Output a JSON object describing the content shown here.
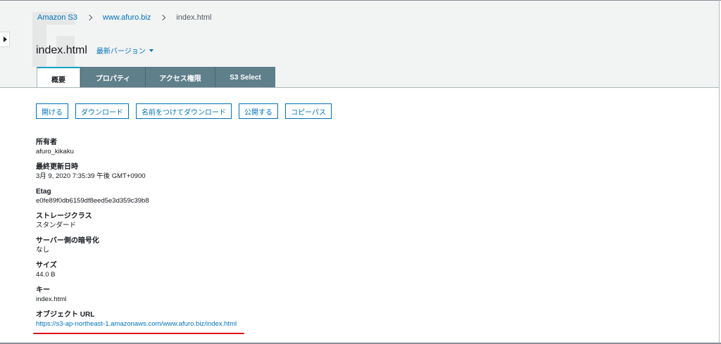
{
  "breadcrumb": {
    "root": "Amazon S3",
    "bucket": "www.afuro.biz",
    "object": "index.html"
  },
  "title": {
    "name": "index.html",
    "version_label": "最新バージョン"
  },
  "tabs": [
    {
      "label": "概要",
      "active": true
    },
    {
      "label": "プロパティ",
      "active": false
    },
    {
      "label": "アクセス権限",
      "active": false
    },
    {
      "label": "S3 Select",
      "active": false
    }
  ],
  "actions": {
    "open": "開ける",
    "download": "ダウンロード",
    "download_as": "名前をつけてダウンロード",
    "make_public": "公開する",
    "copy_path": "コピーパス"
  },
  "properties": {
    "owner": {
      "label": "所有者",
      "value": "afuro_kikaku"
    },
    "last_modified": {
      "label": "最終更新日時",
      "value": "3月 9, 2020 7:35:39 午後 GMT+0900"
    },
    "etag": {
      "label": "Etag",
      "value": "e0fe89f0db6159df8eed5e3d359c39b8"
    },
    "storage_class": {
      "label": "ストレージクラス",
      "value": "スタンダード"
    },
    "encryption": {
      "label": "サーバー側の暗号化",
      "value": "なし"
    },
    "size": {
      "label": "サイズ",
      "value": "44.0 B"
    },
    "key": {
      "label": "キー",
      "value": "index.html"
    },
    "object_url": {
      "label": "オブジェクト URL",
      "value": "https://s3-ap-northeast-1.amazonaws.com/www.afuro.biz/index.html"
    }
  },
  "colors": {
    "link": "#0073bb",
    "tab_accent": "#00a1c9",
    "tab_inactive": "#5f7f8a",
    "header_bg": "#f2f3f3",
    "annotation": "#e0101a"
  }
}
